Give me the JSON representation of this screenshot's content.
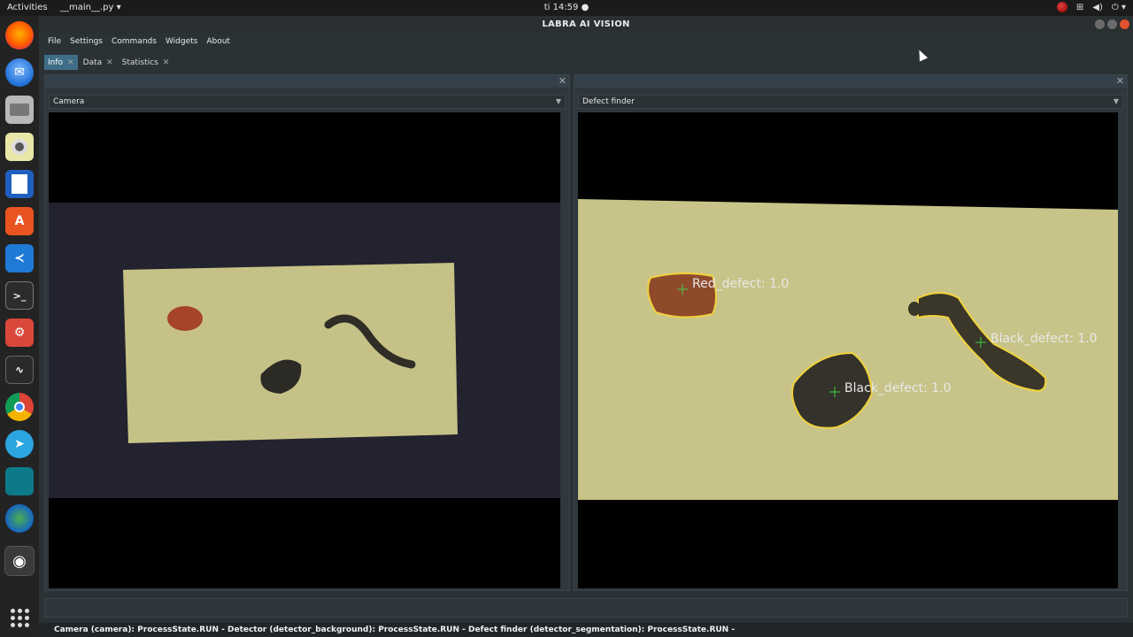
{
  "topbar": {
    "activities": "Activities",
    "app_menu": "__main__.py ▾",
    "clock": "ti 14:59 ●"
  },
  "window": {
    "title": "LABRA AI VISION"
  },
  "menu": [
    "File",
    "Settings",
    "Commands",
    "Widgets",
    "About"
  ],
  "tabs": [
    {
      "label": "Info",
      "active": true
    },
    {
      "label": "Data",
      "active": false
    },
    {
      "label": "Statistics",
      "active": false
    }
  ],
  "left_panel": {
    "source": "Camera"
  },
  "right_panel": {
    "source": "Defect finder",
    "detections": [
      {
        "label": "Red_defect: 1.0"
      },
      {
        "label": "Black_defect: 1.0"
      },
      {
        "label": "Black_defect: 1.0"
      }
    ]
  },
  "status": {
    "text": "Camera (camera): ProcessState.RUN - Detector (detector_background): ProcessState.RUN - Defect finder (detector_segmentation): ProcessState.RUN -"
  },
  "colors": {
    "tab_active": "#3e6d87",
    "contour": "#f0d23c",
    "plate": "#c8c489",
    "marker": "#3fd13f"
  },
  "icons": {
    "dock": [
      "firefox-icon",
      "thunderbird-icon",
      "files-icon",
      "rhythmbox-icon",
      "writer-icon",
      "software-icon",
      "vscode-icon",
      "terminal-icon",
      "tools-icon",
      "system-monitor-icon",
      "chrome-icon",
      "telegram-icon",
      "app-icon",
      "world-icon",
      "eye-icon",
      "show-apps-icon"
    ]
  }
}
